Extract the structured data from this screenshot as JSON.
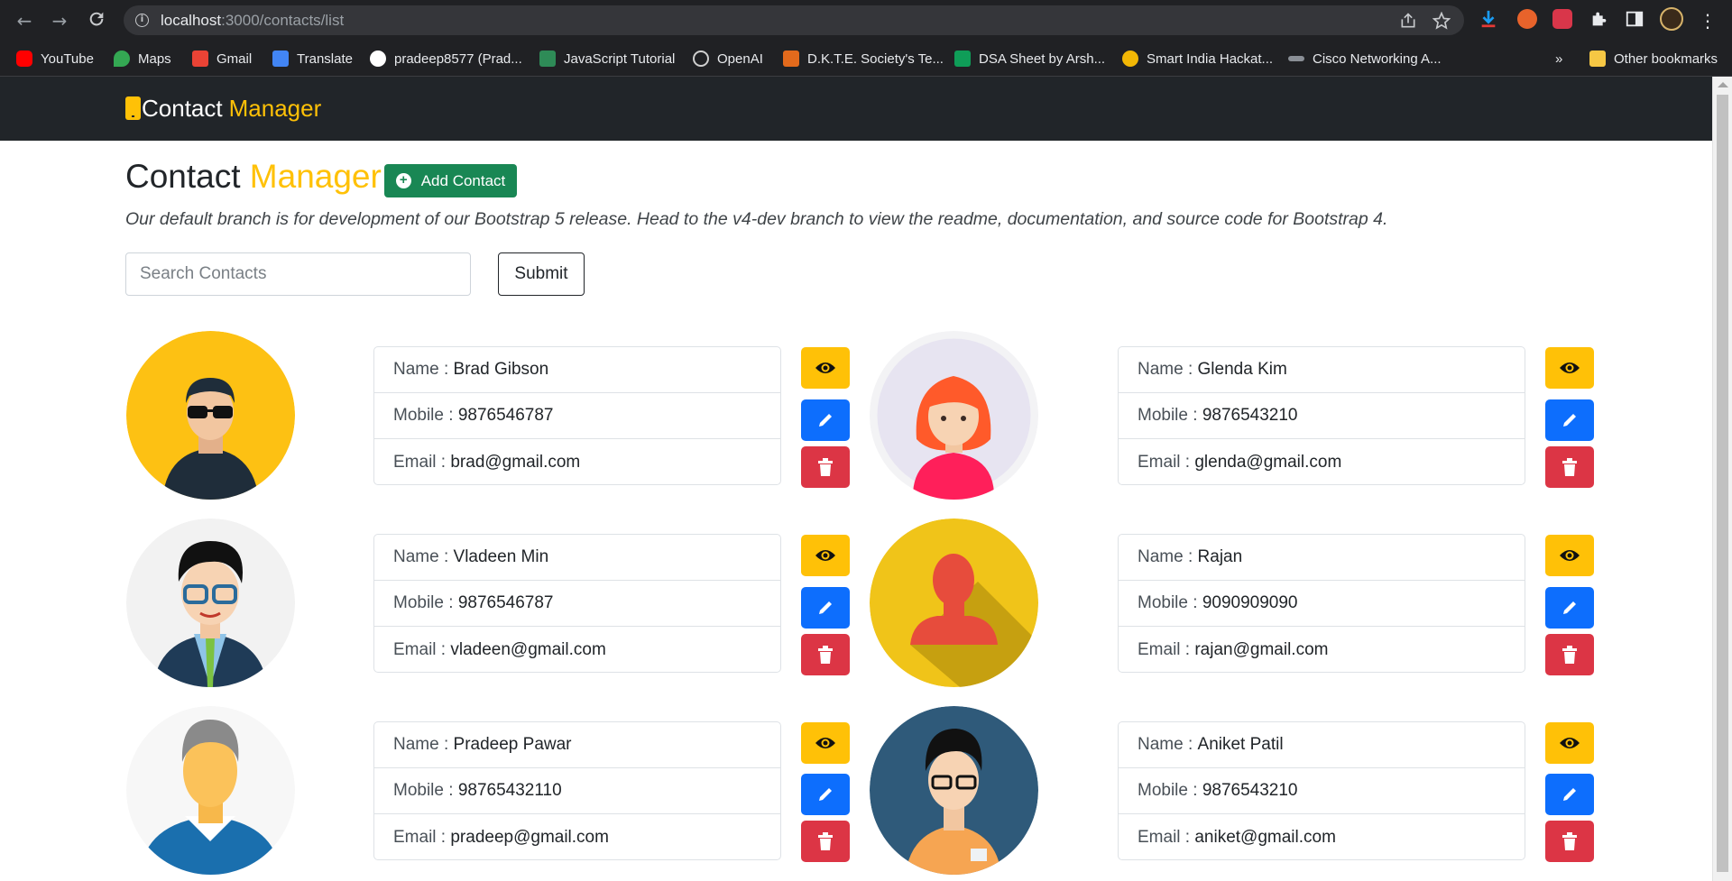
{
  "browser": {
    "url_host": "localhost",
    "url_path": ":3000/contacts/list",
    "bookmarks": [
      {
        "label": "YouTube",
        "color": "#ff0000"
      },
      {
        "label": "Maps",
        "color": "#34a853"
      },
      {
        "label": "Gmail",
        "color": "#ea4335"
      },
      {
        "label": "Translate",
        "color": "#4285f4"
      },
      {
        "label": "pradeep8577 (Prad...",
        "color": "#ffffff"
      },
      {
        "label": "JavaScript Tutorial",
        "color": "#2e8b57"
      },
      {
        "label": "OpenAI",
        "color": "#cfcfcf"
      },
      {
        "label": "D.K.T.E. Society's Te...",
        "color": "#e36a1c"
      },
      {
        "label": "DSA Sheet by Arsh...",
        "color": "#0f9d58"
      },
      {
        "label": "Smart India Hackat...",
        "color": "#f2b705"
      },
      {
        "label": "Cisco Networking A...",
        "color": "#8a8f96"
      }
    ],
    "more_bookmarks": "»",
    "other_bookmarks": "Other bookmarks"
  },
  "navbar": {
    "brand_main": "Contact",
    "brand_accent": "Manager"
  },
  "page": {
    "title_main": "Contact",
    "title_accent": "Manager",
    "add_button": "Add Contact",
    "description": "Our default branch is for development of our Bootstrap 5 release. Head to the v4-dev branch to view the readme, documentation, and source code for Bootstrap 4.",
    "search_placeholder": "Search Contacts",
    "submit_label": "Submit"
  },
  "labels": {
    "name": "Name : ",
    "mobile": "Mobile : ",
    "email": "Email : "
  },
  "contacts": [
    {
      "name": "Brad Gibson",
      "mobile": "9876546787",
      "email": "brad@gmail.com",
      "avatar": "man-sunglasses"
    },
    {
      "name": "Glenda Kim",
      "mobile": "9876543210",
      "email": "glenda@gmail.com",
      "avatar": "woman-red-hair"
    },
    {
      "name": "Vladeen Min",
      "mobile": "9876546787",
      "email": "vladeen@gmail.com",
      "avatar": "man-glasses-suit"
    },
    {
      "name": "Rajan",
      "mobile": "9090909090",
      "email": "rajan@gmail.com",
      "avatar": "user-silhouette"
    },
    {
      "name": "Pradeep Pawar",
      "mobile": "98765432110",
      "email": "pradeep@gmail.com",
      "avatar": "man-gray-hair"
    },
    {
      "name": "Aniket Patil",
      "mobile": "9876543210",
      "email": "aniket@gmail.com",
      "avatar": "man-glasses-badge"
    }
  ],
  "colors": {
    "accent": "#ffc107",
    "navbar": "#212529",
    "success": "#198754",
    "primary": "#0d6efd",
    "danger": "#dc3545"
  }
}
